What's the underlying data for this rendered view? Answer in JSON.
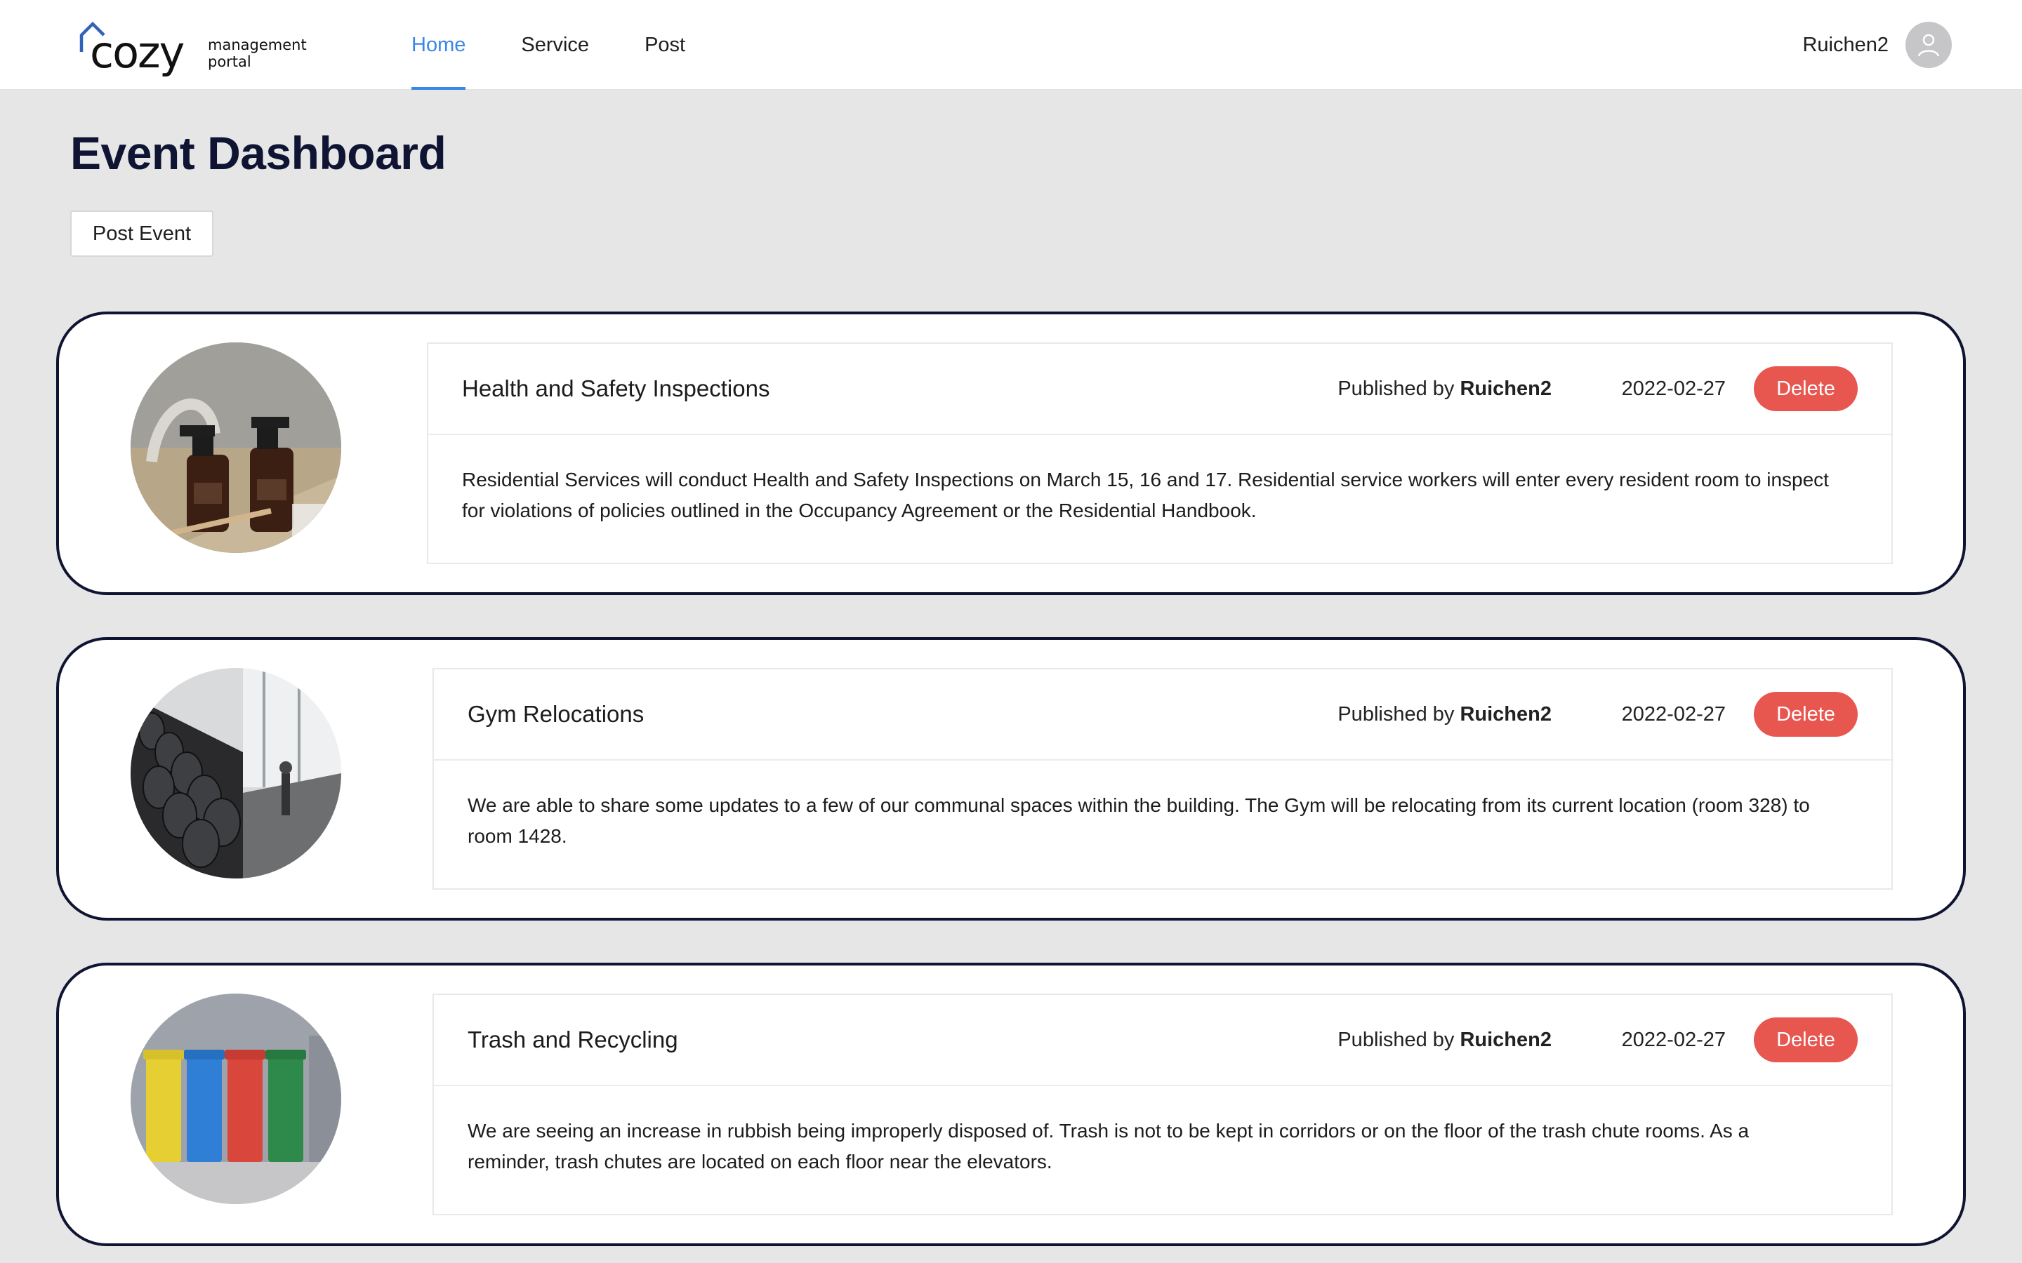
{
  "header": {
    "logo_word": "cozy",
    "logo_sub_1": "management",
    "logo_sub_2": "portal",
    "nav": [
      "Home",
      "Service",
      "Post"
    ],
    "active_nav": "Home",
    "username": "Ruichen2",
    "accent_color": "#3a86e8"
  },
  "page": {
    "title": "Event Dashboard",
    "post_button": "Post Event"
  },
  "events": [
    {
      "title": "Health and Safety Inspections",
      "published_prefix": "Published by ",
      "author": "Ruichen2",
      "date": "2022-02-27",
      "delete_label": "Delete",
      "body": "Residential Services will conduct Health and Safety Inspections on March 15, 16 and 17. Residential service workers will enter every resident room to inspect for violations of policies outlined in the Occupancy Agreement or the Residential Handbook.",
      "image": "cleaning-spray-bottles-photo"
    },
    {
      "title": "Gym Relocations",
      "published_prefix": "Published by ",
      "author": "Ruichen2",
      "date": "2022-02-27",
      "delete_label": "Delete",
      "body": "We are able to share some updates to a few of our communal spaces within the building. The Gym will be relocating from its current location (room 328) to room 1428.",
      "image": "gym-dumbbells-photo"
    },
    {
      "title": "Trash and Recycling",
      "published_prefix": "Published by ",
      "author": "Ruichen2",
      "date": "2022-02-27",
      "delete_label": "Delete",
      "body": "We are seeing an increase in rubbish being improperly disposed of. Trash is not to be kept in corridors or on the floor of the trash chute rooms. As a reminder, trash chutes are located on each floor near the elevators.",
      "image": "recycling-bins-photo"
    }
  ],
  "colors": {
    "delete": "#e85650",
    "card_border": "#0f1433",
    "background": "#e6e6e7"
  }
}
